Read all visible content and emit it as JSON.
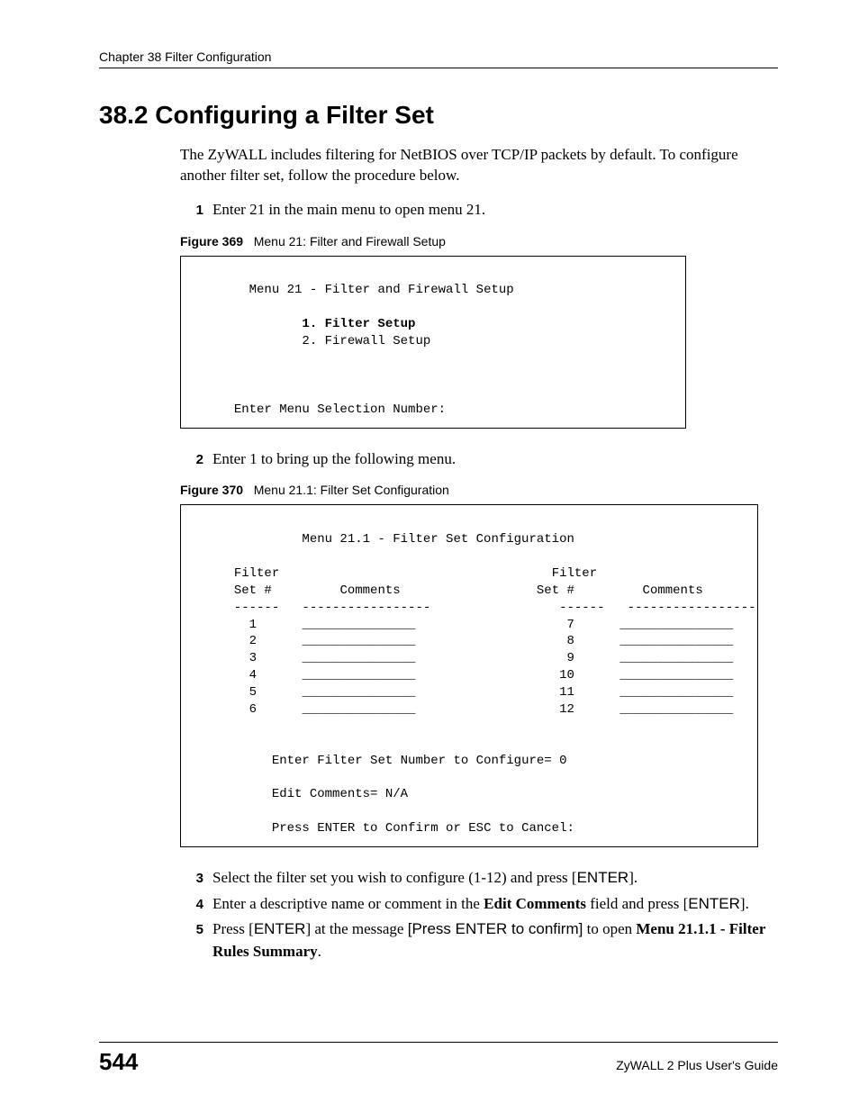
{
  "header": {
    "chapter_line": "Chapter 38 Filter Configuration"
  },
  "section": {
    "number_and_title": "38.2  Configuring a Filter Set",
    "intro": "The ZyWALL includes filtering for NetBIOS over TCP/IP packets by default. To configure another filter set, follow the procedure below."
  },
  "steps_a": [
    {
      "n": "1",
      "text": "Enter 21 in the main menu to open menu 21."
    }
  ],
  "figure369": {
    "caption_label": "Figure 369",
    "caption_text": "Menu 21: Filter and Firewall Setup",
    "title": "Menu 21 - Filter and Firewall Setup",
    "option1": "1. Filter Setup",
    "option2": "2. Firewall Setup",
    "prompt": "Enter Menu Selection Number:"
  },
  "steps_b": [
    {
      "n": "2",
      "text": "Enter 1 to bring up the following menu."
    }
  ],
  "figure370": {
    "caption_label": "Figure 370",
    "caption_text": "Menu 21.1: Filter Set Configuration",
    "title": "Menu 21.1 - Filter Set Configuration",
    "col_h1a": "Filter",
    "col_h1b": "Set #",
    "col_h2": "Comments",
    "col_h3a": "Filter",
    "col_h3b": "Set #",
    "col_h4": "Comments",
    "rows_left": [
      "1",
      "2",
      "3",
      "4",
      "5",
      "6"
    ],
    "rows_right": [
      "7",
      "8",
      "9",
      "10",
      "11",
      "12"
    ],
    "line_enter": "Enter Filter Set Number to Configure= 0",
    "line_edit": "Edit Comments= N/A",
    "line_press": "Press ENTER to Confirm or ESC to Cancel:"
  },
  "steps_c": [
    {
      "n": "3",
      "html": "Select the filter set you wish to configure (1-12) and press [<span class=\"sans\">ENTER</span>]."
    },
    {
      "n": "4",
      "html": "Enter a descriptive name or comment in the <b>Edit Comments</b> field and press [<span class=\"sans\">ENTER</span>]."
    },
    {
      "n": "5",
      "html": "Press [<span class=\"sans\">ENTER</span>] at the message <span class=\"sans\">[Press ENTER to confirm]</span> to open <b>Menu 21.1.1 - Filter Rules Summary</b>."
    }
  ],
  "footer": {
    "page_number": "544",
    "guide": "ZyWALL 2 Plus User's Guide"
  }
}
